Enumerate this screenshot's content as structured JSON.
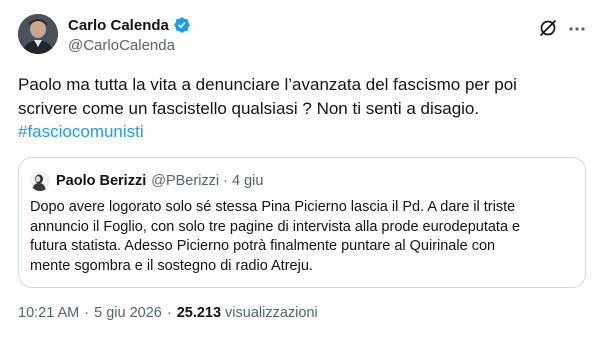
{
  "author": {
    "name": "Carlo Calenda",
    "handle": "@CarloCalenda",
    "verified_icon": "verified-badge-icon",
    "verified_color": "#1d9bf0"
  },
  "actions": {
    "grok_icon": "grok-icon",
    "more_icon": "more-dots-icon"
  },
  "tweet": {
    "line1": "Paolo ma tutta la vita a denunciare l’avanzata del fascismo per poi",
    "line2": "scrivere come un fascistello qualsiasi ? Non ti senti a disagio.",
    "hashtag": "#fasciocomunisti"
  },
  "quote": {
    "author_name": "Paolo Berizzi",
    "author_handle": "@PBerizzi",
    "separator": "·",
    "time": "4 giu",
    "lines": [
      "Dopo avere logorato solo sé stessa Pina Picierno lascia il Pd. A dare il triste",
      "annuncio il Foglio, con solo tre pagine di intervista alla prode eurodeputata e",
      "futura statista. Adesso Picierno potrà finalmente puntare al Quirinale con",
      "mente sgombra e il sostegno di radio Atreju."
    ]
  },
  "meta": {
    "time": "10:21 AM",
    "separator": "·",
    "date": "5 giu 2026",
    "views_count": "25.213",
    "views_label": "visualizzazioni"
  },
  "colors": {
    "text": "#0f1419",
    "secondary": "#536471",
    "accent": "#1d9bf0",
    "border": "#cfd9de"
  }
}
